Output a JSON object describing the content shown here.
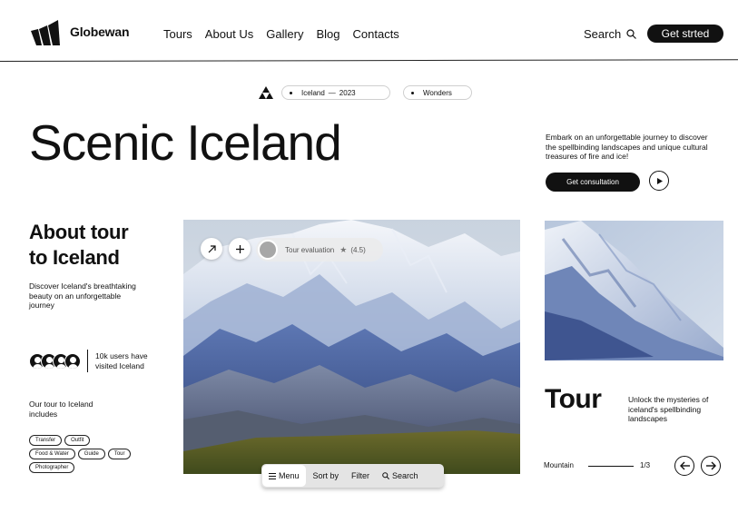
{
  "header": {
    "brand": "Globewan",
    "nav": [
      "Tours",
      "About Us",
      "Gallery",
      "Blog",
      "Contacts"
    ],
    "search_label": "Search",
    "cta_label": "Get strted"
  },
  "crumbs": {
    "pill1_place": "Iceland",
    "pill1_sep": "—",
    "pill1_year": "2023",
    "pill2_label": "Wonders"
  },
  "hero": {
    "title": "Scenic Iceland",
    "description": "Embark on an unforgettable journey to discover the spellbinding landscapes and unique cultural treasures of fire and ice!",
    "consult_label": "Get consultation"
  },
  "about": {
    "title_line1": "About tour",
    "title_line2": "to Iceland",
    "description": "Discover Iceland's breathtaking beauty on an unforgettable journey",
    "users_text": "10k users have visited Iceland",
    "includes_text": "Our tour to Iceland includes",
    "tags": [
      "Transfer",
      "Outfit",
      "Food & Water",
      "Guide",
      "Tour",
      "Photographer"
    ]
  },
  "photo_overlay": {
    "eval_label": "Tour evaluation",
    "eval_score": "(4.5)"
  },
  "toolbar": {
    "menu": "Menu",
    "sort": "Sort by",
    "filter": "Filter",
    "search": "Search"
  },
  "tour_card": {
    "title": "Tour",
    "description": "Unlock the mysteries of iceland's spellbinding landscapes",
    "slide_label": "Mountain",
    "slide_count": "1/3"
  },
  "icons": {
    "logo": "globewan-logo-icon",
    "search": "search-icon",
    "triangles": "triangles-icon",
    "play": "play-icon",
    "arrow_up_right": "arrow-up-right-icon",
    "plus": "plus-icon",
    "star": "star-icon",
    "menu": "menu-icon",
    "arrow_left": "arrow-left-icon",
    "arrow_right": "arrow-right-icon"
  },
  "colors": {
    "ink": "#111111",
    "background": "#ffffff",
    "toolbar_bg": "#e4e4e4"
  }
}
